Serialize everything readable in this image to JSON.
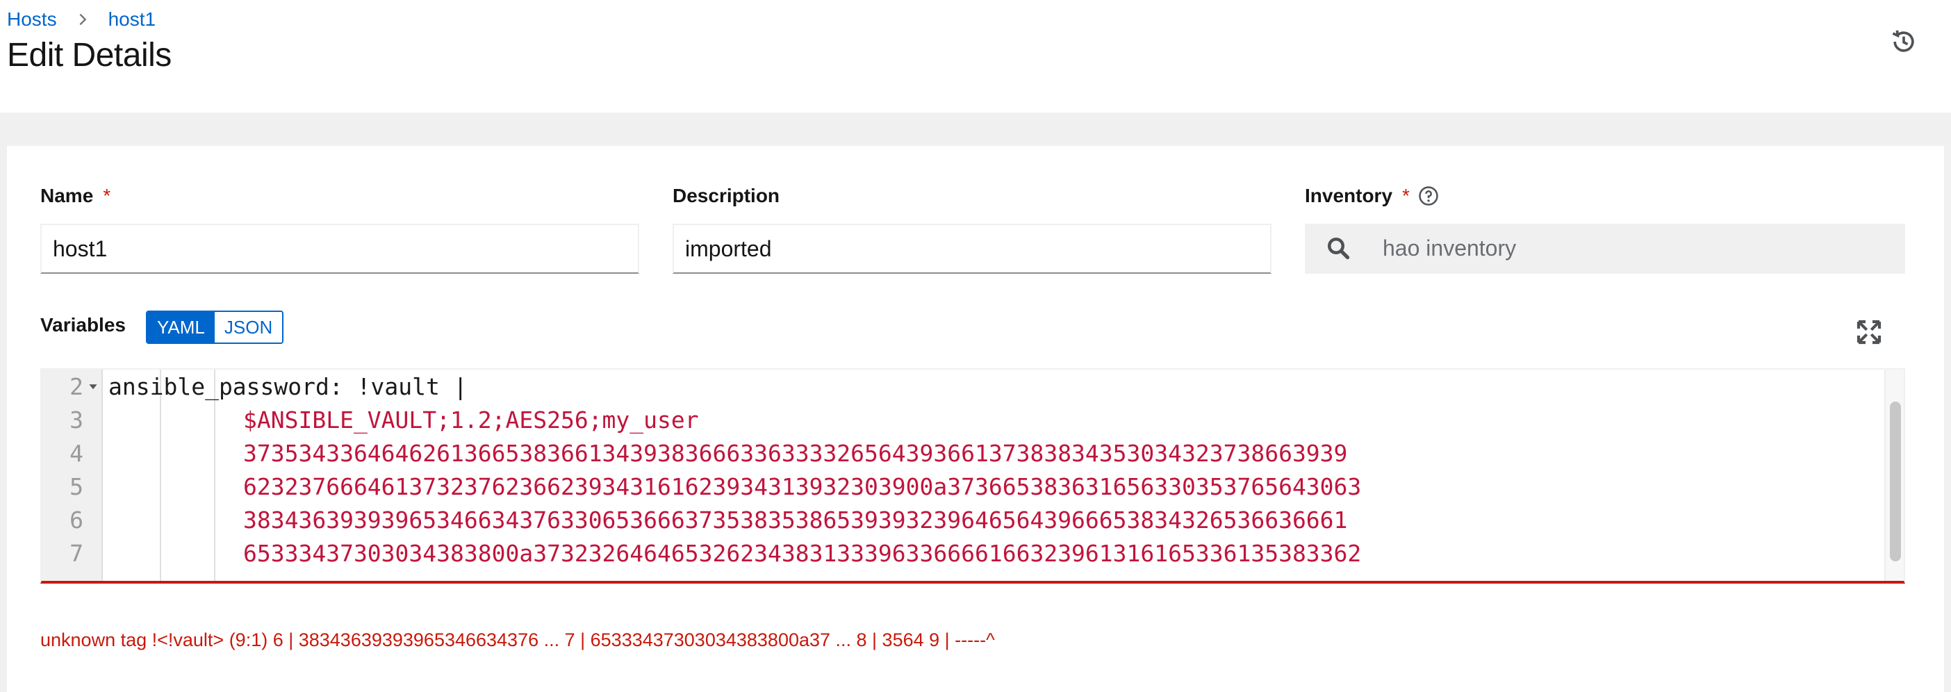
{
  "breadcrumb": {
    "root": "Hosts",
    "current": "host1"
  },
  "page": {
    "title": "Edit Details"
  },
  "form": {
    "name_label": "Name",
    "name_value": "host1",
    "description_label": "Description",
    "description_value": "imported",
    "inventory_label": "Inventory",
    "inventory_value": "hao inventory",
    "required_mark": "*",
    "variables_label": "Variables",
    "format_options": [
      "YAML",
      "JSON"
    ],
    "format_selected": "YAML"
  },
  "editor": {
    "lines": [
      {
        "num": "2",
        "text": "ansible_password: !vault |",
        "foldable": true
      },
      {
        "num": "3",
        "text": "$ANSIBLE_VAULT;1.2;AES256;my_user"
      },
      {
        "num": "4",
        "text": "37353433646462613665383661343938366633633332656439366137383834353034323738663939"
      },
      {
        "num": "5",
        "text": "62323766646137323762366239343161623934313932303900a373665383631656330353765643063"
      },
      {
        "num": "6",
        "text": "38343639393965346634376330653666373538353865393932396465643966653834326536636661"
      },
      {
        "num": "7",
        "text": "65333437303034383800a373232646465326234383133396336666166323961316165336135383362"
      }
    ]
  },
  "error_message": "unknown tag !<!vault> (9:1) 6 | 38343639393965346634376 ... 7 | 65333437303034383800a37 ... 8 | 3564 9 | -----^",
  "icons": {
    "history": "history-icon",
    "help": "help-icon",
    "search": "search-icon",
    "expand": "expand-icon",
    "breadcrumb_sep": "chevron-right-icon",
    "fold": "fold-caret-icon"
  },
  "colors": {
    "link": "#0066cc",
    "error": "#c9190b",
    "string": "#c0143c"
  }
}
